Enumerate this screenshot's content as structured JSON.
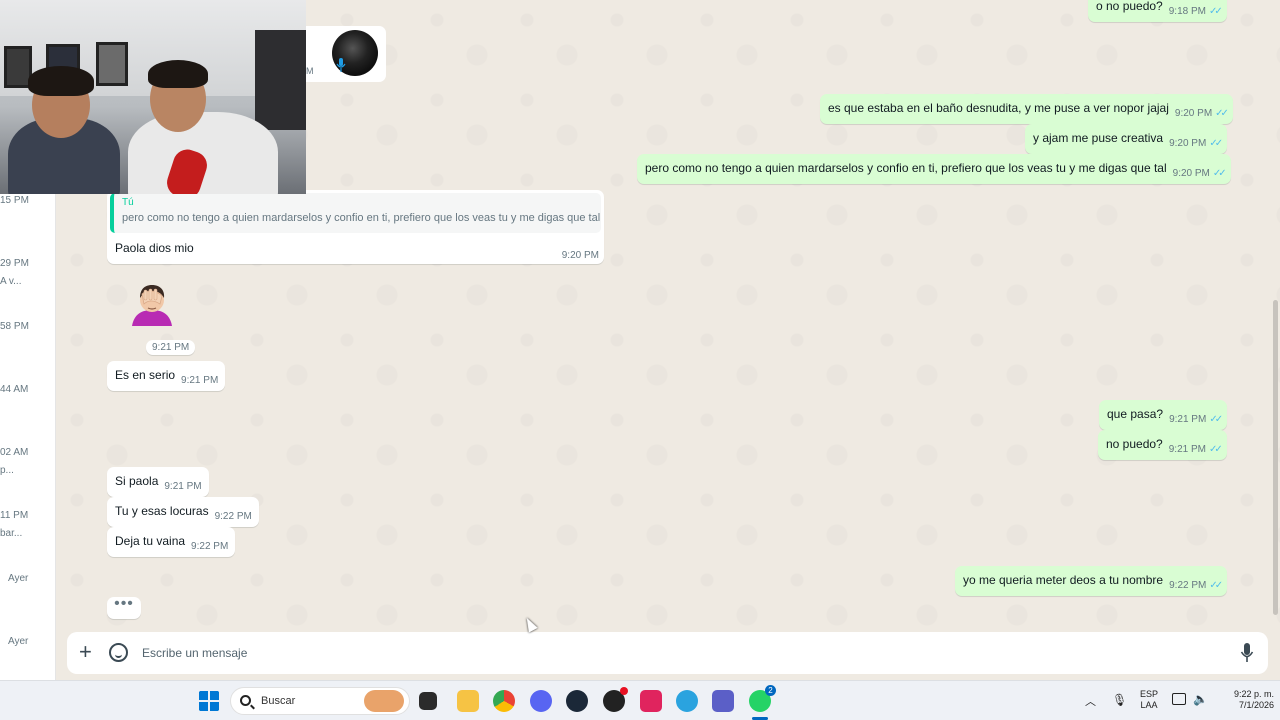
{
  "chat_list": {
    "entries": [
      {
        "time": "15 PM",
        "preview": ""
      },
      {
        "time": "29 PM",
        "preview": "A v..."
      },
      {
        "time": "58 PM",
        "preview": ""
      },
      {
        "time": "44 AM",
        "preview": ""
      },
      {
        "time": "02 AM",
        "preview": "p..."
      },
      {
        "time": "11 PM",
        "preview": "bar..."
      },
      {
        "time": "Ayer",
        "preview": ""
      },
      {
        "time": "Ayer",
        "preview": ""
      }
    ]
  },
  "audio": {
    "cut_label": "M"
  },
  "outgoing": [
    {
      "text": "o no puedo?",
      "time": "9:18 PM"
    },
    {
      "text": "es que estaba en el baño desnudita, y me puse a ver nopor jajaj",
      "time": "9:20 PM"
    },
    {
      "text": "y ajam me puse creativa",
      "time": "9:20 PM"
    },
    {
      "text": "pero como no tengo a quien mardarselos y confio en ti, prefiero que los veas tu y me digas que tal",
      "time": "9:20 PM"
    },
    {
      "text": "que pasa?",
      "time": "9:21 PM"
    },
    {
      "text": "no puedo?",
      "time": "9:21 PM"
    },
    {
      "text": "yo me queria meter deos a tu nombre",
      "time": "9:22 PM"
    }
  ],
  "reply": {
    "author": "Tú",
    "quoted": "pero como no tengo a quien mardarselos y confio en ti, prefiero que los veas tu y me digas que tal",
    "body": "Paola dios mio",
    "time": "9:20 PM"
  },
  "sticker": {
    "icon": "facepalm-emoji",
    "time": "9:21 PM"
  },
  "incoming": [
    {
      "text": "Es en serio",
      "time": "9:21 PM"
    },
    {
      "text": "Si paola",
      "time": "9:21 PM"
    },
    {
      "text": "Tu y esas locuras",
      "time": "9:22 PM"
    },
    {
      "text": "Deja tu vaina",
      "time": "9:22 PM"
    }
  ],
  "typing": "•••",
  "composer": {
    "placeholder": "Escribe un mensaje"
  },
  "taskbar": {
    "search_label": "Buscar",
    "lang_top": "ESP",
    "lang_bottom": "LAA",
    "clock_time": "9:22 p. m.",
    "clock_date": "7/1/2026",
    "whatsapp_badge": "2"
  },
  "colors": {
    "outgoing_bubble": "#d9fdd3",
    "incoming_bubble": "#ffffff",
    "read_ticks": "#53bdeb",
    "chat_bg": "#efeae2"
  }
}
